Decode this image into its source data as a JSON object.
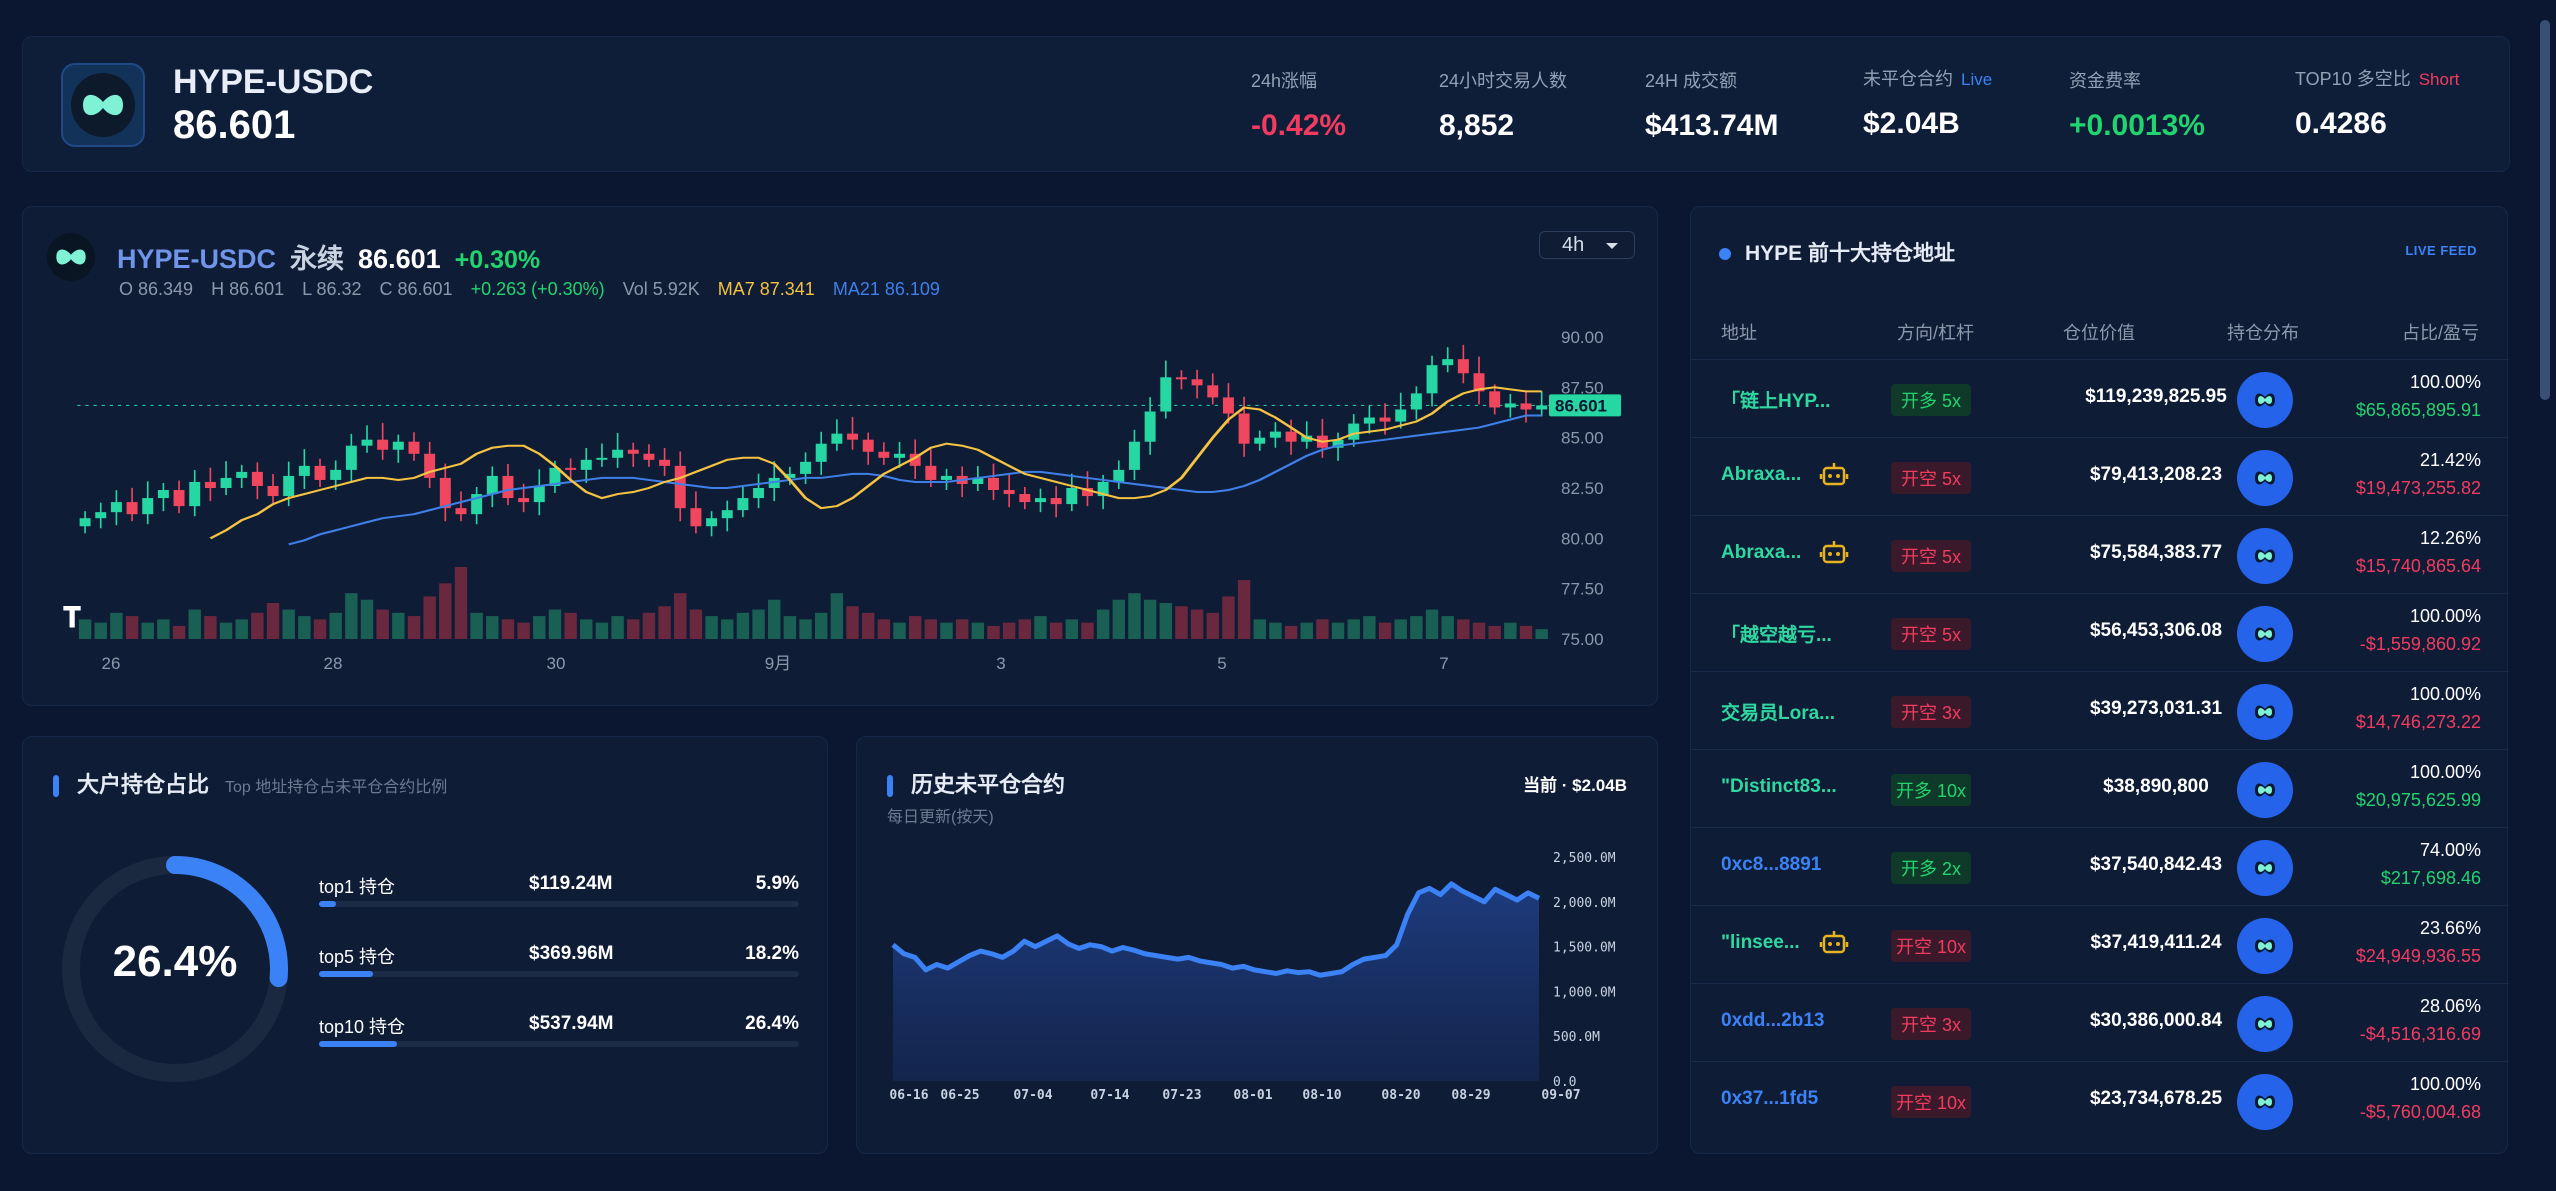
{
  "header": {
    "pair": "HYPE-USDC",
    "price": "86.601",
    "stats": [
      {
        "label": "24h涨幅",
        "value": "-0.42%",
        "tone": "neg",
        "tag": ""
      },
      {
        "label": "24小时交易人数",
        "value": "8,852",
        "tone": "wht",
        "tag": ""
      },
      {
        "label": "24H 成交额",
        "value": "$413.74M",
        "tone": "wht",
        "tag": ""
      },
      {
        "label": "未平仓合约",
        "value": "$2.04B",
        "tone": "wht",
        "tag": "Live"
      },
      {
        "label": "资金费率",
        "value": "+0.0013%",
        "tone": "pos",
        "tag": ""
      },
      {
        "label": "TOP10 多空比",
        "value": "0.4286",
        "tone": "wht",
        "tag": "Short"
      }
    ]
  },
  "chart": {
    "pair": "HYPE-USDC",
    "type_label": "永续",
    "price": "86.601",
    "change": "+0.30%",
    "timeframe": "4h",
    "ohlc": {
      "o": "O 86.349",
      "h": "H 86.601",
      "l": "L 86.32",
      "c": "C 86.601",
      "chg": "+0.263 (+0.30%)",
      "vol": "Vol 5.92K",
      "ma7": "MA7 87.341",
      "ma21": "MA21 86.109"
    },
    "last_price_label": "86.601"
  },
  "chart_data": [
    {
      "type": "candlestick",
      "title": "HYPE-USDC 4h",
      "y_ticks": [
        "90.00",
        "87.50",
        "85.00",
        "82.50",
        "80.00",
        "77.50",
        "75.00"
      ],
      "ylim": [
        75,
        90
      ],
      "x_ticks": [
        "26",
        "28",
        "30",
        "9月",
        "3",
        "5",
        "7"
      ],
      "last_price": 86.601,
      "colors": {
        "up": "#26d7a3",
        "down": "#f0475f",
        "ma7": "#f5c242",
        "ma21": "#3f7fe8"
      },
      "close_series": [
        81.0,
        81.3,
        81.8,
        81.2,
        82.0,
        82.4,
        81.6,
        82.8,
        82.5,
        83.0,
        83.3,
        82.6,
        82.1,
        83.1,
        83.6,
        82.9,
        83.4,
        84.6,
        84.9,
        84.4,
        84.8,
        84.2,
        83.0,
        81.5,
        81.2,
        82.2,
        83.1,
        82.0,
        81.8,
        82.6,
        83.5,
        83.4,
        83.9,
        84.0,
        84.4,
        84.2,
        83.9,
        83.6,
        81.5,
        80.6,
        81.0,
        81.4,
        82.0,
        82.5,
        83.0,
        83.2,
        83.8,
        84.7,
        85.2,
        84.9,
        84.3,
        84.0,
        84.2,
        83.6,
        82.9,
        83.1,
        82.7,
        83.0,
        82.4,
        82.2,
        81.8,
        82.0,
        81.7,
        82.5,
        82.1,
        82.8,
        83.4,
        84.8,
        86.3,
        88.0,
        87.9,
        87.6,
        87.0,
        86.2,
        84.7,
        85.0,
        85.3,
        84.8,
        85.1,
        84.5,
        84.9,
        85.7,
        86.0,
        85.8,
        86.4,
        87.2,
        88.6,
        88.9,
        88.2,
        87.3,
        86.5,
        86.7,
        86.4,
        86.6
      ],
      "volume_series": [
        6,
        5,
        8,
        7,
        5,
        6,
        4,
        9,
        7,
        5,
        6,
        8,
        11,
        9,
        7,
        6,
        8,
        14,
        12,
        9,
        8,
        7,
        13,
        17,
        22,
        8,
        7,
        6,
        5,
        7,
        9,
        8,
        6,
        5,
        7,
        6,
        8,
        10,
        14,
        9,
        7,
        6,
        8,
        9,
        12,
        7,
        6,
        8,
        14,
        10,
        8,
        6,
        5,
        7,
        6,
        5,
        6,
        5,
        4,
        5,
        6,
        7,
        5,
        6,
        5,
        9,
        12,
        14,
        12,
        11,
        10,
        9,
        8,
        13,
        18,
        6,
        5,
        4,
        5,
        6,
        5,
        6,
        7,
        5,
        6,
        7,
        9,
        7,
        6,
        5,
        4,
        5,
        4,
        3
      ],
      "ma7_series": [
        80.0,
        80.4,
        80.9,
        81.2,
        81.7,
        82.0,
        82.2,
        82.4,
        82.6,
        82.8,
        83.0,
        83.0,
        82.9,
        83.0,
        83.3,
        83.5,
        83.7,
        84.2,
        84.5,
        84.6,
        84.6,
        84.2,
        83.6,
        82.9,
        82.3,
        82.0,
        82.2,
        82.3,
        82.5,
        82.8,
        83.0,
        83.3,
        83.6,
        83.9,
        84.0,
        84.0,
        83.7,
        82.9,
        82.0,
        81.5,
        81.6,
        82.0,
        82.6,
        83.2,
        83.6,
        84.0,
        84.5,
        84.7,
        84.6,
        84.4,
        84.0,
        83.6,
        83.2,
        83.0,
        82.8,
        82.6,
        82.4,
        82.2,
        82.0,
        82.0,
        82.1,
        82.4,
        83.0,
        84.0,
        85.0,
        85.9,
        86.5,
        86.4,
        86.0,
        85.5,
        85.0,
        84.8,
        84.9,
        85.2,
        85.3,
        85.4,
        85.6,
        85.8,
        86.2,
        86.8,
        87.2,
        87.4,
        87.5,
        87.4,
        87.3,
        87.3
      ],
      "ma21_series": [
        79.7,
        79.9,
        80.2,
        80.4,
        80.6,
        80.8,
        81.0,
        81.1,
        81.2,
        81.4,
        81.6,
        81.8,
        82.0,
        82.2,
        82.4,
        82.5,
        82.6,
        82.7,
        82.8,
        82.9,
        83.0,
        83.0,
        83.0,
        82.9,
        82.8,
        82.7,
        82.6,
        82.5,
        82.5,
        82.6,
        82.7,
        82.8,
        82.9,
        83.0,
        83.0,
        83.1,
        83.2,
        83.2,
        83.1,
        82.9,
        82.8,
        82.8,
        82.8,
        82.9,
        83.0,
        83.1,
        83.2,
        83.3,
        83.3,
        83.2,
        83.1,
        83.0,
        82.9,
        82.8,
        82.7,
        82.6,
        82.5,
        82.4,
        82.3,
        82.3,
        82.4,
        82.6,
        82.9,
        83.3,
        83.7,
        84.1,
        84.4,
        84.6,
        84.7,
        84.8,
        84.9,
        85.0,
        85.1,
        85.2,
        85.3,
        85.4,
        85.5,
        85.7,
        85.9,
        86.1,
        86.1
      ]
    },
    {
      "type": "area",
      "title": "历史未平仓合约",
      "y_ticks": [
        "2,500.0M",
        "2,000.0M",
        "1,500.0M",
        "1,000.0M",
        "500.0M",
        "0.0"
      ],
      "ylim": [
        0,
        2500
      ],
      "x_ticks": [
        "06-16",
        "06-25",
        "07-04",
        "07-14",
        "07-23",
        "08-01",
        "08-10",
        "08-20",
        "08-29",
        "09-07"
      ],
      "color": "#3b82f6",
      "values": [
        1520,
        1420,
        1380,
        1240,
        1300,
        1260,
        1330,
        1400,
        1450,
        1420,
        1380,
        1450,
        1560,
        1500,
        1560,
        1620,
        1530,
        1480,
        1520,
        1500,
        1450,
        1490,
        1460,
        1420,
        1400,
        1380,
        1360,
        1380,
        1340,
        1320,
        1300,
        1260,
        1280,
        1240,
        1220,
        1200,
        1230,
        1210,
        1220,
        1180,
        1200,
        1220,
        1300,
        1360,
        1380,
        1400,
        1520,
        1860,
        2100,
        2150,
        2080,
        2200,
        2120,
        2060,
        2000,
        2140,
        2080,
        2020,
        2100,
        2040
      ]
    }
  ],
  "holders": {
    "title": "HYPE 前十大持仓地址",
    "live_feed": "LIVE FEED",
    "headers": {
      "addr": "地址",
      "side": "方向/杠杆",
      "value": "仓位价值",
      "dist": "持仓分布",
      "pct": "占比/盈亏"
    },
    "rows": [
      {
        "addr": "「链上HYP...",
        "side": "开多 5x",
        "dir": "long",
        "value": "$119,239,825.95",
        "pct": "100.00%",
        "pnl": "$65,865,895.91",
        "pnl_tone": "pos",
        "robot": false,
        "addr_tone": "green"
      },
      {
        "addr": "Abraxa...",
        "side": "开空 5x",
        "dir": "short",
        "value": "$79,413,208.23",
        "pct": "21.42%",
        "pnl": "$19,473,255.82",
        "pnl_tone": "neg",
        "robot": true,
        "addr_tone": "green"
      },
      {
        "addr": "Abraxa...",
        "side": "开空 5x",
        "dir": "short",
        "value": "$75,584,383.77",
        "pct": "12.26%",
        "pnl": "$15,740,865.64",
        "pnl_tone": "neg",
        "robot": true,
        "addr_tone": "green"
      },
      {
        "addr": "「越空越亏...",
        "side": "开空 5x",
        "dir": "short",
        "value": "$56,453,306.08",
        "pct": "100.00%",
        "pnl": "-$1,559,860.92",
        "pnl_tone": "neg",
        "robot": false,
        "addr_tone": "green"
      },
      {
        "addr": "交易员Lora...",
        "side": "开空 3x",
        "dir": "short",
        "value": "$39,273,031.31",
        "pct": "100.00%",
        "pnl": "$14,746,273.22",
        "pnl_tone": "neg",
        "robot": false,
        "addr_tone": "green"
      },
      {
        "addr": "\"Distinct83...",
        "side": "开多 10x",
        "dir": "long",
        "value": "$38,890,800",
        "pct": "100.00%",
        "pnl": "$20,975,625.99",
        "pnl_tone": "pos",
        "robot": false,
        "addr_tone": "green"
      },
      {
        "addr": "0xc8...8891",
        "side": "开多 2x",
        "dir": "long",
        "value": "$37,540,842.43",
        "pct": "74.00%",
        "pnl": "$217,698.46",
        "pnl_tone": "pos",
        "robot": false,
        "addr_tone": "blue"
      },
      {
        "addr": "\"linsee...",
        "side": "开空 10x",
        "dir": "short",
        "value": "$37,419,411.24",
        "pct": "23.66%",
        "pnl": "$24,949,936.55",
        "pnl_tone": "neg",
        "robot": true,
        "addr_tone": "green"
      },
      {
        "addr": "0xdd...2b13",
        "side": "开空 3x",
        "dir": "short",
        "value": "$30,386,000.84",
        "pct": "28.06%",
        "pnl": "-$4,516,316.69",
        "pnl_tone": "neg",
        "robot": false,
        "addr_tone": "blue"
      },
      {
        "addr": "0x37...1fd5",
        "side": "开空 10x",
        "dir": "short",
        "value": "$23,734,678.25",
        "pct": "100.00%",
        "pnl": "-$5,760,004.68",
        "pnl_tone": "neg",
        "robot": false,
        "addr_tone": "blue"
      }
    ]
  },
  "concentration": {
    "title": "大户持仓占比",
    "subtitle": "Top 地址持仓占未平仓合约比例",
    "gauge_value": "26.4%",
    "gauge_fraction": 0.264,
    "rows": [
      {
        "label": "top1 持仓",
        "value": "$119.24M",
        "pct": "5.9%",
        "fraction": 0.059
      },
      {
        "label": "top5 持仓",
        "value": "$369.96M",
        "pct": "18.2%",
        "fraction": 0.182
      },
      {
        "label": "top10 持仓",
        "value": "$537.94M",
        "pct": "26.4%",
        "fraction": 0.264
      }
    ]
  },
  "open_interest": {
    "title": "历史未平仓合约",
    "subtitle": "每日更新(按天)",
    "current": "当前 · $2.04B"
  }
}
